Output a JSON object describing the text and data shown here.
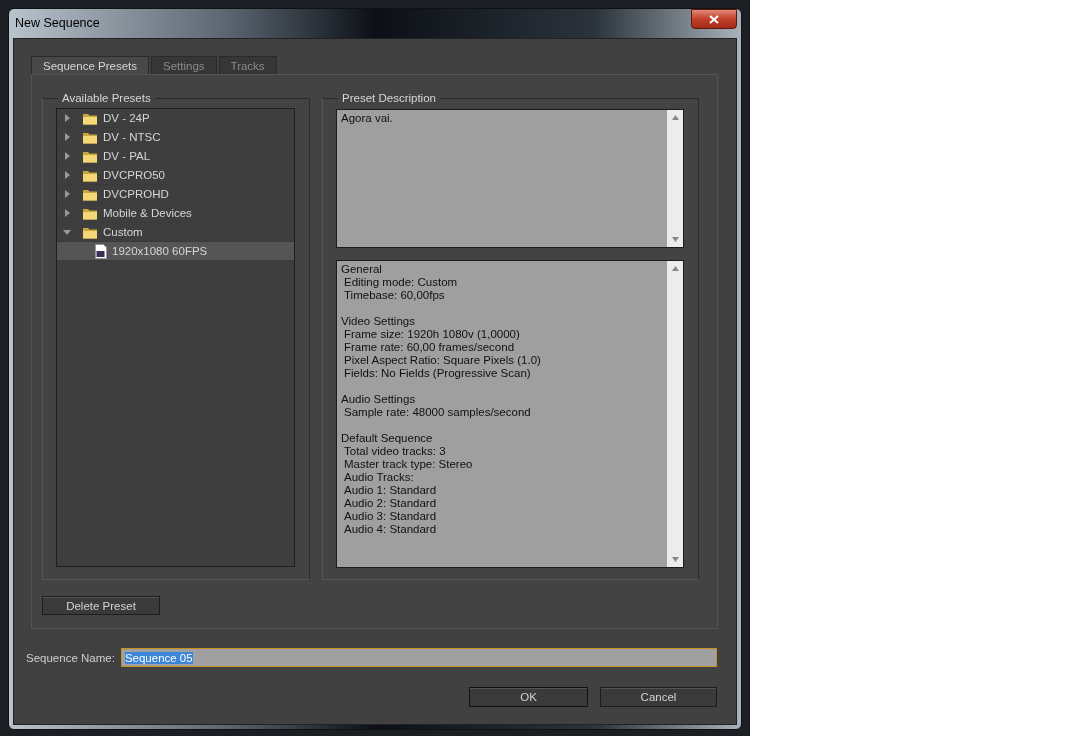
{
  "window": {
    "title": "New Sequence"
  },
  "tabs": [
    {
      "label": "Sequence Presets",
      "selected": true
    },
    {
      "label": "Settings",
      "selected": false
    },
    {
      "label": "Tracks",
      "selected": false
    }
  ],
  "presets": {
    "title": "Available Presets",
    "items": [
      {
        "label": "DV - 24P",
        "kind": "folder",
        "expanded": false,
        "selected": false
      },
      {
        "label": "DV - NTSC",
        "kind": "folder",
        "expanded": false,
        "selected": false
      },
      {
        "label": "DV - PAL",
        "kind": "folder",
        "expanded": false,
        "selected": false
      },
      {
        "label": "DVCPRO50",
        "kind": "folder",
        "expanded": false,
        "selected": false
      },
      {
        "label": "DVCPROHD",
        "kind": "folder",
        "expanded": false,
        "selected": false
      },
      {
        "label": "Mobile & Devices",
        "kind": "folder",
        "expanded": false,
        "selected": false
      },
      {
        "label": "Custom",
        "kind": "folder",
        "expanded": true,
        "selected": false,
        "children": [
          {
            "label": "1920x1080 60FPS",
            "kind": "preset",
            "selected": true
          }
        ]
      }
    ]
  },
  "description": {
    "title": "Preset Description",
    "text": "Agora vai.",
    "details": [
      {
        "heading": "General",
        "lines": [
          "Editing mode: Custom",
          "Timebase: 60,00fps"
        ]
      },
      {
        "heading": "Video Settings",
        "lines": [
          "Frame size: 1920h 1080v (1,0000)",
          "Frame rate: 60,00 frames/second",
          "Pixel Aspect Ratio: Square Pixels (1.0)",
          "Fields: No Fields (Progressive Scan)"
        ]
      },
      {
        "heading": "Audio Settings",
        "lines": [
          "Sample rate: 48000 samples/second"
        ]
      },
      {
        "heading": "Default Sequence",
        "lines": [
          "Total video tracks: 3",
          "Master track type: Stereo",
          "Audio Tracks:",
          "Audio 1: Standard",
          "Audio 2: Standard",
          "Audio 3: Standard",
          "Audio 4: Standard"
        ]
      }
    ]
  },
  "delete_button": "Delete Preset",
  "sequence_name": {
    "label": "Sequence Name:",
    "value": "Sequence 05",
    "text_highlighted": true
  },
  "buttons": [
    "OK",
    "Cancel"
  ]
}
